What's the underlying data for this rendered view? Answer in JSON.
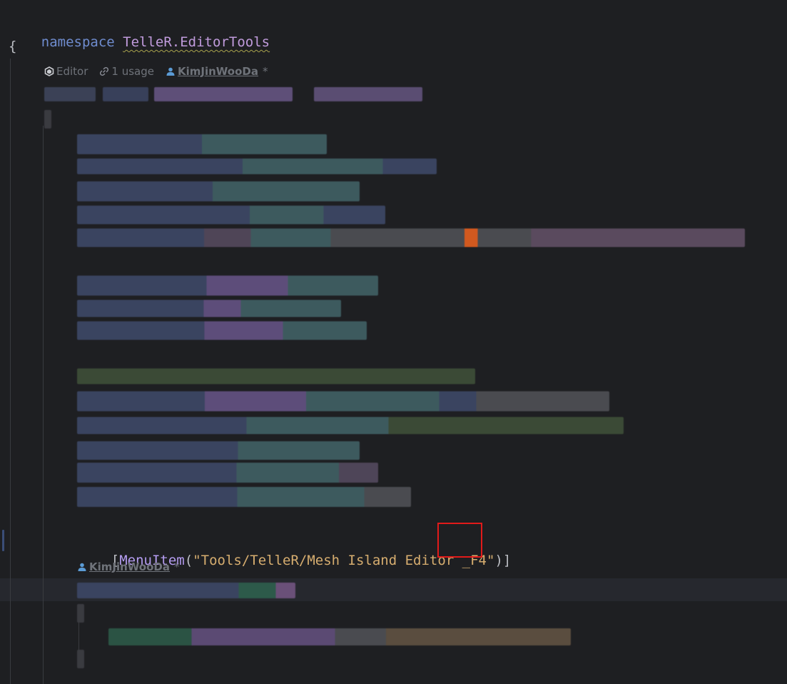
{
  "code": {
    "namespace_keyword": "namespace",
    "namespace_name": "TelleR.EditorTools",
    "open_brace": "{",
    "class_hint": {
      "scope": "Editor",
      "usages": "1 usage",
      "author": "KimJinWooDa",
      "modified_marker": "*"
    },
    "attribute_line": {
      "open_bracket": "[",
      "attribute": "MenuItem",
      "open_paren": "(",
      "string_value": "\"Tools/TelleR/Mesh Island Editor _F4\"",
      "close": ")]"
    },
    "method_hint": {
      "author": "KimJinWooDa",
      "modified_marker": "*"
    }
  },
  "colors": {
    "background": "#1e1f22",
    "keyword": "#6f8ccf",
    "namespace": "#c09bdc",
    "attribute": "#b49cf0",
    "string": "#d6ad6f",
    "highlight_box": "#e11a1a",
    "hint_text": "#6f737a"
  },
  "icons": {
    "scope_icon": "unity-icon",
    "usage_icon": "link-icon",
    "author_icon": "person-icon"
  }
}
